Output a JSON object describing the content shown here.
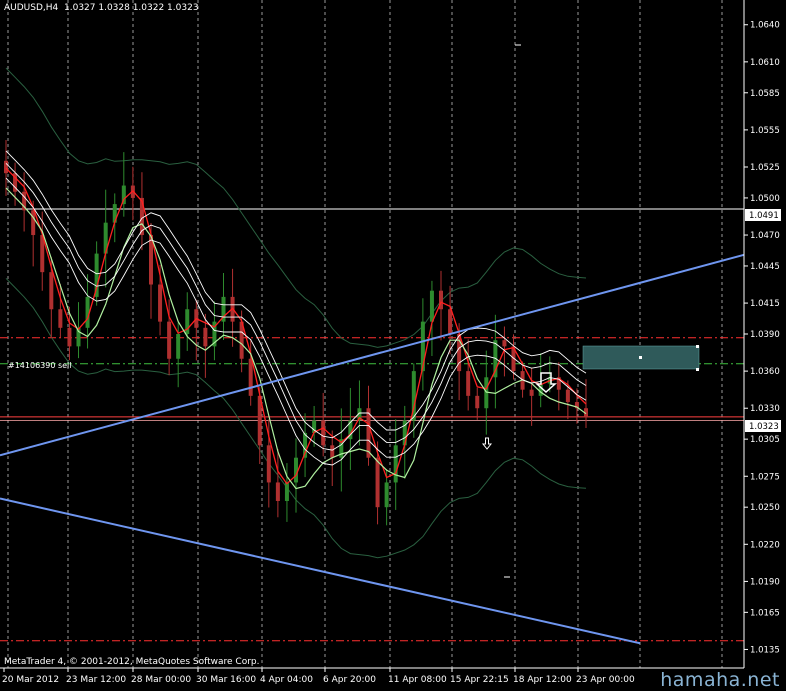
{
  "header": {
    "symbol": "AUDUSD,H4",
    "ohlc": "1.0327 1.0328 1.0322 1.0323"
  },
  "footer": {
    "copyright": "MetaTrader 4, © 2001-2012, MetaQuotes Software Corp."
  },
  "watermark": "hamaha.net",
  "trade_label": "#14106390 sell",
  "current_price": "1.0323",
  "marked_price": "1.0491",
  "colors": {
    "background": "#000000",
    "bull": "#2e8b2e",
    "bear": "#b03030",
    "ma_red": "#ff2020",
    "ma_green": "#b0f0a0",
    "envelope": "#ffffff",
    "bands": "#2a6040",
    "trend": "#6f96f0",
    "zone": "#2f5a5a"
  },
  "chart_data": {
    "type": "candlestick",
    "title": "AUDUSD,H4",
    "ylim": [
      1.012,
      1.066
    ],
    "y_ticks": [
      "1.0640",
      "1.0610",
      "1.0585",
      "1.0555",
      "1.0525",
      "1.0500",
      "1.0470",
      "1.0445",
      "1.0415",
      "1.0390",
      "1.0360",
      "1.0330",
      "1.0305",
      "1.0275",
      "1.0250",
      "1.0220",
      "1.0190",
      "1.0165",
      "1.0135"
    ],
    "x_ticks": [
      "20 Mar 2012",
      "23 Mar 12:00",
      "28 Mar 00:00",
      "30 Mar 16:00",
      "4 Apr 04:00",
      "6 Apr 20:00",
      "11 Apr 08:00",
      "15 Apr 22:15",
      "18 Apr 12:00",
      "23 Apr 00:00"
    ],
    "horizontal_lines": [
      {
        "price": 1.0491,
        "color": "#ffffff",
        "style": "solid"
      },
      {
        "price": 1.0323,
        "color": "#ff4040",
        "style": "solid"
      },
      {
        "price": 1.0387,
        "color": "#ff3030",
        "style": "dashdot"
      },
      {
        "price": 1.0366,
        "color": "#40c040",
        "style": "dashdot"
      },
      {
        "price": 1.0142,
        "color": "#ff3030",
        "style": "dashdot"
      }
    ],
    "trend_lines": [
      {
        "from": [
          "20 Mar 2012",
          1.0292
        ],
        "to": [
          "24 Apr",
          1.0454
        ]
      },
      {
        "from": [
          "20 Mar 2012",
          1.0257
        ],
        "to": [
          "24 Apr",
          1.0126
        ]
      }
    ],
    "close": [
      1.052,
      1.0505,
      1.049,
      1.047,
      1.044,
      1.041,
      1.0395,
      1.038,
      1.0395,
      1.042,
      1.0455,
      1.048,
      1.0495,
      1.051,
      1.05,
      1.047,
      1.043,
      1.04,
      1.037,
      1.039,
      1.041,
      1.0395,
      1.038,
      1.04,
      1.042,
      1.04,
      1.037,
      1.034,
      1.03,
      1.027,
      1.0255,
      1.027,
      1.029,
      1.031,
      1.032,
      1.03,
      1.029,
      1.0305,
      1.032,
      1.033,
      1.029,
      1.025,
      1.027,
      1.03,
      1.032,
      1.036,
      1.04,
      1.0425,
      1.041,
      1.039,
      1.036,
      1.034,
      1.033,
      1.0355,
      1.0385,
      1.038,
      1.036,
      1.0345,
      1.034,
      1.035,
      1.0355,
      1.0345,
      1.0335,
      1.033,
      1.0323
    ]
  }
}
